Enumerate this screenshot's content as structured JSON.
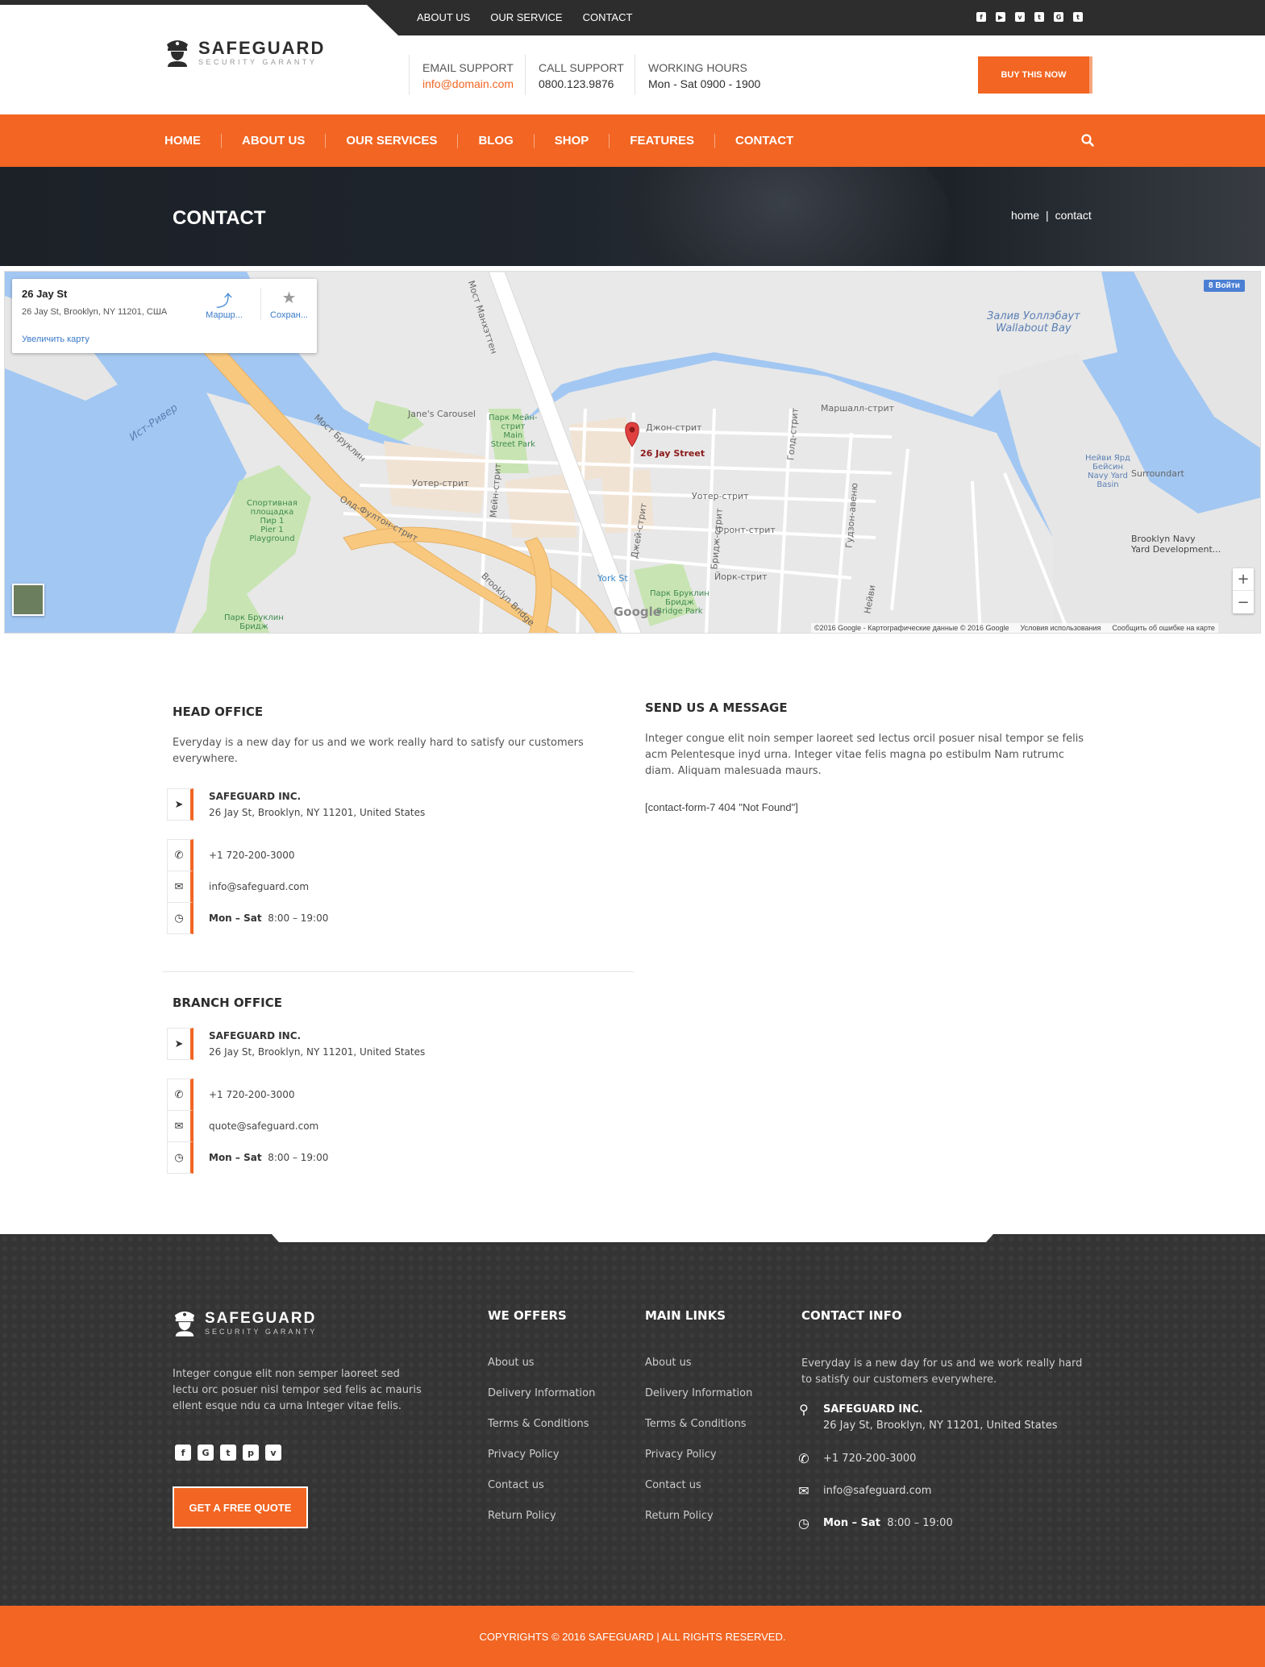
{
  "topbar": {
    "links": [
      "ABOUT US",
      "OUR SERVICE",
      "CONTACT"
    ],
    "socials": [
      "facebook-icon",
      "youtube-icon",
      "vimeo-icon",
      "twitter-icon",
      "google-plus-icon",
      "tumblr-icon"
    ]
  },
  "header": {
    "brand": "SAFEGUARD",
    "tagline": "SECURITY GARANTY",
    "email_label": "EMAIL SUPPORT",
    "email_value": "info@domain.com",
    "call_label": "CALL SUPPORT",
    "call_value": "0800.123.9876",
    "hours_label": "WORKING HOURS",
    "hours_value": "Mon - Sat 0900 - 1900",
    "buy_label": "BUY THIS NOW"
  },
  "nav": {
    "items": [
      "HOME",
      "ABOUT US",
      "OUR SERVICES",
      "BLOG",
      "SHOP",
      "FEATURES",
      "CONTACT"
    ]
  },
  "banner": {
    "title": "CONTACT",
    "crumb_home": "home",
    "crumb_sep": "|",
    "crumb_current": "contact"
  },
  "map": {
    "place_name": "26 Jay St",
    "place_address": "26 Jay St, Brooklyn, NY 11201, США",
    "directions_label": "Маршр...",
    "save_label": "Сохран...",
    "larger_map_label": "Увеличить карту",
    "signin_label": "8 Войти",
    "marker_label": "26 Jay Street",
    "zoom_in": "+",
    "zoom_out": "−",
    "google": "Google",
    "attrib_data": "©2016 Google - Картографические данные © 2016 Google",
    "attrib_terms": "Условия использования",
    "attrib_report": "Сообщить об ошибке на карте",
    "labels": {
      "bay": "Залив Уоллэбаут\nWallabout Bay",
      "east_river": "Ист-Ривер",
      "carousel": "Jane's Carousel",
      "main_park": "Парк Мейн-\nстрит\nMain\nStreet Park",
      "john_st": "Джон-стрит",
      "marshall_st": "Маршалл-стрит",
      "water_st": "Уотер-стрит",
      "water_st2": "Уотер-стрит",
      "front_st": "Фронт-стрит",
      "york_st": "Йорк-стрит",
      "york_station": "York St",
      "bridge_park": "Парк Бруклин\nБридж\nBridge Park",
      "bridge_park_left": "Парк Бруклин\nБридж",
      "pier1": "Спортивная\nплощадка\nПир 1\nPier 1\nPlayground",
      "brooklyn_bridge": "Мост Бруклин",
      "brooklyn_bridge_en": "Brooklyn Bridge",
      "old_fulton": "Олд-Фултон-стрит",
      "navy_yard": "Нейви Ярд\nБейсин\nNavy Yard\nBasin",
      "surroundart": "Surroundart",
      "navy_dev": "Brooklyn Navy\nYard Development...",
      "manhattan_bridge": "Мост Манхэттен",
      "jay_st": "Джей-стрит",
      "main_st": "Мейн-стрит",
      "bridge_st": "Бридж-стрит",
      "gold_st": "Голд-стрит",
      "hudson_ave": "Гудзон-авеню",
      "navy_st": "Нейви"
    }
  },
  "head_office": {
    "title": "HEAD OFFICE",
    "intro": "Everyday is a new day for us and we work really hard to satisfy our customers everywhere.",
    "company": "SAFEGUARD INC.",
    "address": "26 Jay St, Brooklyn, NY 11201, United States",
    "phone": "+1 720-200-3000",
    "email": "info@safeguard.com",
    "hours_days": "Mon – Sat",
    "hours_time": "8:00 – 19:00"
  },
  "branch_office": {
    "title": "BRANCH OFFICE",
    "company": "SAFEGUARD INC.",
    "address": "26 Jay St, Brooklyn, NY 11201, United States",
    "phone": "+1 720-200-3000",
    "email": "quote@safeguard.com",
    "hours_days": "Mon – Sat",
    "hours_time": "8:00 – 19:00"
  },
  "message": {
    "title": "SEND US A MESSAGE",
    "intro": "Integer congue elit noin semper laoreet sed lectus orcil posuer nisal tempor se felis acm Pelentesque inyd urna. Integer vitae felis magna po estibulm Nam rutrumc diam. Aliquam malesuada maurs.",
    "form_error": "[contact-form-7 404 \"Not Found\"]"
  },
  "footer": {
    "brand": "SAFEGUARD",
    "tagline": "SECURITY GARANTY",
    "about": "Integer congue elit non semper laoreet sed lectu orc posuer nisl tempor sed felis ac mauris ellent esque ndu ca urna Integer vitae felis.",
    "socials": [
      "facebook-icon",
      "google-plus-icon",
      "twitter-icon",
      "pinterest-icon",
      "vimeo-icon"
    ],
    "quote_btn": "GET A FREE QUOTE",
    "offers_title": "WE OFFERS",
    "offers": [
      "About us",
      "Delivery Information",
      "Terms & Conditions",
      "Privacy Policy",
      "Contact us",
      "Return Policy"
    ],
    "links_title": "MAIN LINKS",
    "links": [
      "About us",
      "Delivery Information",
      "Terms & Conditions",
      "Privacy Policy",
      "Contact us",
      "Return Policy"
    ],
    "contact_title": "CONTACT INFO",
    "contact_intro": "Everyday is a new day for us and we work really hard to satisfy our customers everywhere.",
    "company": "SAFEGUARD INC.",
    "address": "26 Jay St, Brooklyn, NY 11201, United States",
    "phone": "+1 720-200-3000",
    "email": "info@safeguard.com",
    "hours_days": "Mon – Sat",
    "hours_time": "8:00 – 19:00",
    "copyright": "COPYRIGHTS © 2016 SAFEGUARD | ALL RIGHTS RESERVED."
  },
  "colors": {
    "accent": "#f26522",
    "dark": "#2d2d2d",
    "footer": "#343434"
  }
}
